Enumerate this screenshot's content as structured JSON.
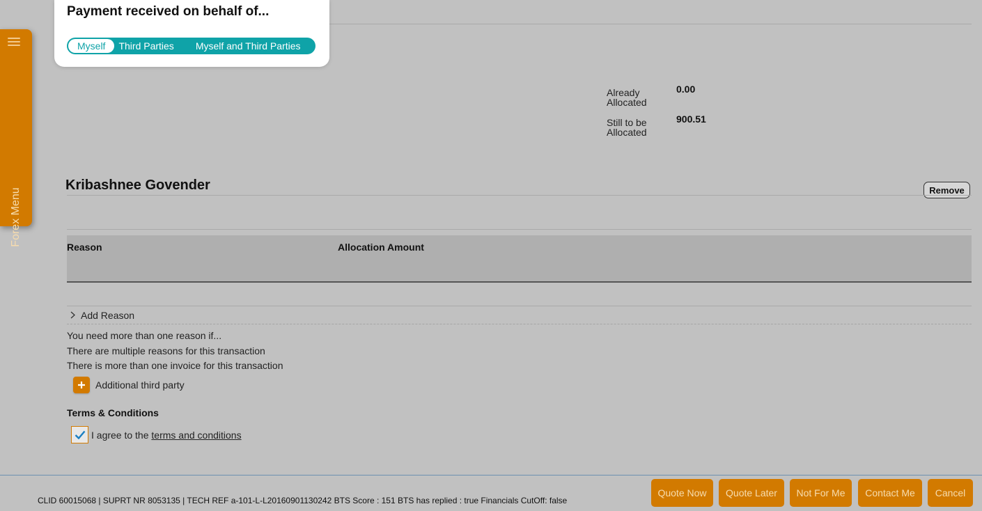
{
  "side_menu": {
    "label": "Forex Menu",
    "icon": "hamburger-icon"
  },
  "popup": {
    "title": "Payment received on behalf of...",
    "options": [
      "Myself",
      "Third Parties",
      "Myself and Third Parties"
    ],
    "selected": "Myself"
  },
  "allocation": {
    "already_label_1": "Already",
    "already_label_2": "Allocated",
    "already_value": "0.00",
    "still_label_1": "Still to be",
    "still_label_2": "Allocated",
    "still_value": "900.51"
  },
  "person": {
    "name": "Kribashnee Govender",
    "remove_label": "Remove"
  },
  "reason_table": {
    "columns": [
      "Reason",
      "Allocation Amount"
    ]
  },
  "add_reason": {
    "label": "Add Reason",
    "icon": "chevron-right-icon"
  },
  "info": {
    "line1": "You need more than one reason if...",
    "line2": "There are multiple reasons for this transaction",
    "line3": "There is more than one invoice for this transaction"
  },
  "additional_third_party": {
    "label": "Additional third party",
    "icon": "plus-icon"
  },
  "terms": {
    "heading": "Terms & Conditions",
    "agree_prefix": "I agree to the ",
    "link_text": "terms and conditions",
    "checked": true
  },
  "footer": {
    "info": "CLID 60015068 | SUPRT NR 8053135 | TECH REF a-101-L-L20160901130242 BTS Score : 151 BTS has replied : true Financials CutOff: false",
    "buttons": [
      "Quote Now",
      "Quote Later",
      "Not For Me",
      "Contact Me",
      "Cancel"
    ]
  },
  "colors": {
    "accent_orange": "#d27a00",
    "toggle_teal": "#0fa3a8",
    "background": "#c1c1c1"
  }
}
